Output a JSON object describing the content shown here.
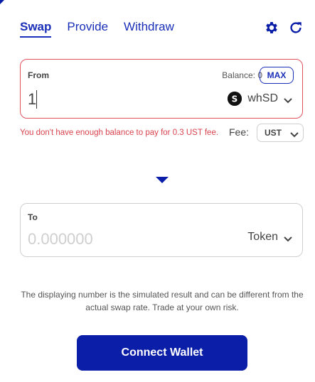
{
  "tabs": [
    {
      "label": "Swap",
      "active": true
    },
    {
      "label": "Provide",
      "active": false
    },
    {
      "label": "Withdraw",
      "active": false
    }
  ],
  "icons": {
    "settings": "gear-icon",
    "refresh": "refresh-icon"
  },
  "from": {
    "label": "From",
    "balance_text": "Balance: 0",
    "max_label": "MAX",
    "amount": "1",
    "token": "whSD",
    "token_icon": "whsd-token-icon"
  },
  "error": "You don't have enough balance to pay for 0.3 UST fee.",
  "fee": {
    "label": "Fee:",
    "selected": "UST"
  },
  "to": {
    "label": "To",
    "amount_placeholder": "0.000000",
    "token": "Token"
  },
  "disclaimer": "The displaying number is the simulated result and can be different from the actual swap rate. Trade at your own risk.",
  "connect_label": "Connect Wallet",
  "colors": {
    "accent": "#0b1ea8",
    "error": "#d9434e",
    "border": "#cfcfcf"
  }
}
